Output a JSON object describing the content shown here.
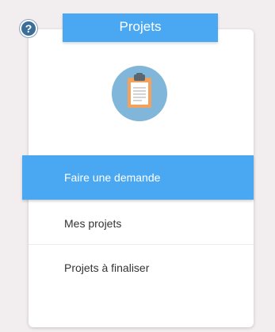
{
  "header": {
    "title": "Projets",
    "help_icon": "question-icon"
  },
  "card": {
    "icon": "clipboard-icon"
  },
  "menu": {
    "items": [
      {
        "label": "Faire une demande",
        "active": true
      },
      {
        "label": "Mes projets",
        "active": false
      },
      {
        "label": "Projets à finaliser",
        "active": false
      }
    ]
  },
  "colors": {
    "accent": "#4aa8f2",
    "icon_circle": "#7fb6d9",
    "help_icon": "#3b6f9a",
    "background": "#f2eeef"
  }
}
